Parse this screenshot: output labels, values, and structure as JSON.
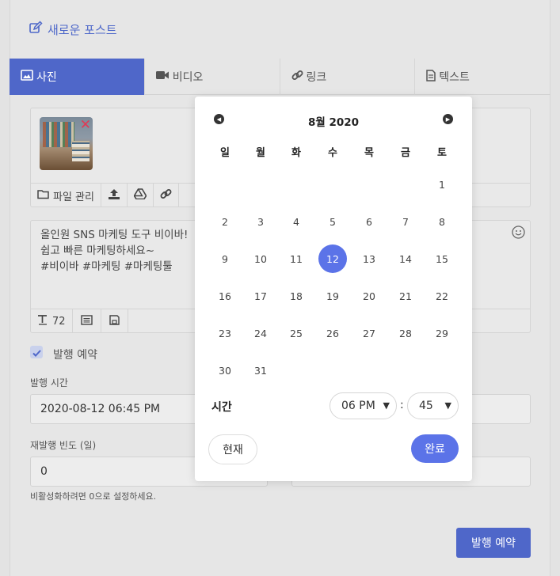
{
  "header": {
    "new_post": "새로운 포스트"
  },
  "tabs": [
    {
      "label": "사진",
      "icon": "image-icon",
      "active": true
    },
    {
      "label": "비디오",
      "icon": "video-icon"
    },
    {
      "label": "링크",
      "icon": "link-icon"
    },
    {
      "label": "텍스트",
      "icon": "document-icon"
    }
  ],
  "media": {
    "file_manager": "파일 관리"
  },
  "caption": {
    "text": "올인원 SNS 마케팅 도구 비이바!\n쉽고 빠른 마케팅하세요~\n#비이바 #마케팅 #마케팅툴",
    "count": "72"
  },
  "schedule": {
    "checkbox_label": "발행 예약",
    "time_label": "발행 시간",
    "time_value": "2020-08-12 06:45 PM",
    "repeat_label": "재발행 빈도 (일)",
    "repeat_value": "0",
    "hint": "비활성화하려면 0으로 설정하세요.",
    "submit": "발행 예약"
  },
  "picker": {
    "month": "8월 2020",
    "weekdays": [
      "일",
      "월",
      "화",
      "수",
      "목",
      "금",
      "토"
    ],
    "days": [
      "1",
      "2",
      "3",
      "4",
      "5",
      "6",
      "7",
      "8",
      "9",
      "10",
      "11",
      "12",
      "13",
      "14",
      "15",
      "16",
      "17",
      "18",
      "19",
      "20",
      "21",
      "22",
      "23",
      "24",
      "25",
      "26",
      "27",
      "28",
      "29",
      "30",
      "31"
    ],
    "selected": "12",
    "time_label": "시간",
    "hour": "06 PM",
    "minute": "45",
    "separator": ":",
    "now": "현재",
    "done": "완료"
  },
  "colors": {
    "accent": "#4f67c9",
    "picker_accent": "#5b73e8",
    "delete": "#e03a55"
  }
}
